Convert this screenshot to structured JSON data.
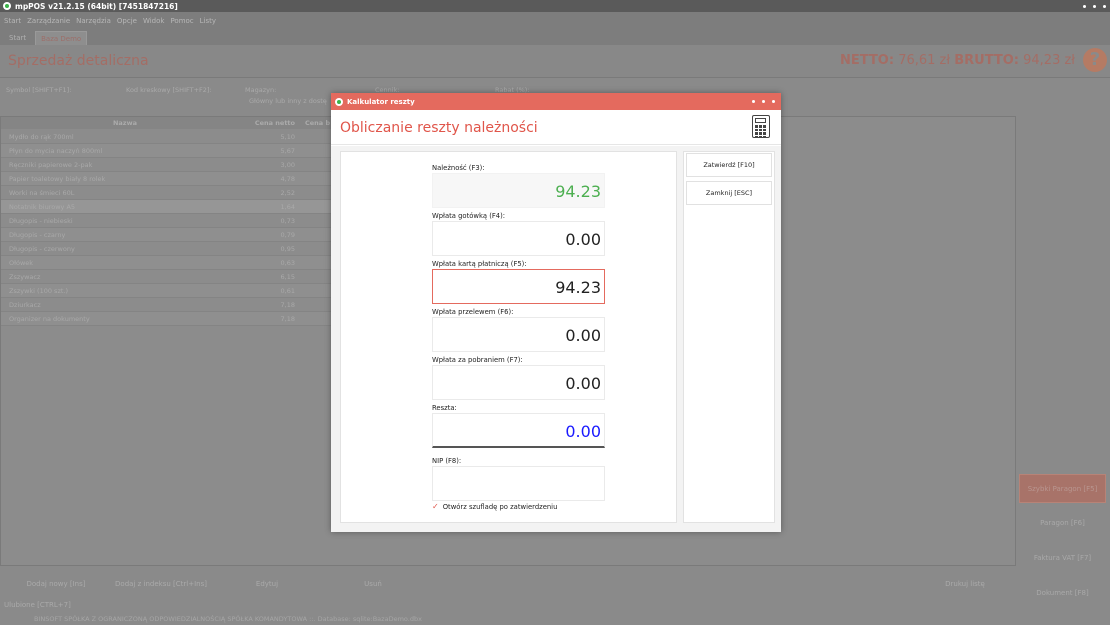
{
  "app": {
    "title": "mpPOS v21.2.15 (64bit) [7451847216]",
    "menu": [
      "Start",
      "Zarządzanie",
      "Narzędzia",
      "Opcje",
      "Widok",
      "Pomoc",
      "Listy"
    ],
    "tabs": [
      "Start",
      "Baza Demo"
    ],
    "page_title": "Sprzedaż detaliczna",
    "totals": {
      "netto_label": "NETTO:",
      "netto_value": "76,61 zł",
      "brutto_label": "BRUTTO:",
      "brutto_value": "94,23 zł"
    },
    "help_glyph": "?"
  },
  "fields": {
    "symbol": "Symbol [SHIFT+F1]:",
    "barcode": "Kod kreskowy [SHIFT+F2]:",
    "warehouse": "Magazyn:",
    "warehouse_value": "Główny lub inny z dostę",
    "pricelist": "Cennik:",
    "discount": "Rabat (%):"
  },
  "table": {
    "headers": [
      "Nazwa",
      "Cena netto",
      "Cena b"
    ],
    "rows": [
      {
        "name": "Mydło do rąk 700ml",
        "net": "5,10"
      },
      {
        "name": "Płyn do mycia naczyń 800ml",
        "net": "5,67"
      },
      {
        "name": "Ręczniki papierowe 2-pak",
        "net": "3,00"
      },
      {
        "name": "Papier toaletowy biały 8 rolek",
        "net": "4,78"
      },
      {
        "name": "Worki na śmieci 60L",
        "net": "2,52"
      },
      {
        "name": "Notatnik biurowy A5",
        "net": "1,64"
      },
      {
        "name": "Długopis - niebieski",
        "net": "0,73"
      },
      {
        "name": "Długopis - czarny",
        "net": "0,79"
      },
      {
        "name": "Długopis - czerwony",
        "net": "0,95"
      },
      {
        "name": "Ołówek",
        "net": "0,63"
      },
      {
        "name": "Zszywacz",
        "net": "6,15"
      },
      {
        "name": "Zszywki (100 szt.)",
        "net": "0,61"
      },
      {
        "name": "Dziurkacz",
        "net": "7,18"
      },
      {
        "name": "Organizer na dokumenty",
        "net": "7,18"
      }
    ]
  },
  "bottom": {
    "add_new": "Dodaj nowy [Ins]",
    "add_index": "Dodaj z indeksu [Ctrl+Ins]",
    "edit": "Edytuj",
    "remove": "Usuń",
    "print_list": "Drukuj listę",
    "favorites": "Ulubione [CTRL+7]",
    "status": "BINSOFT SPÓŁKA Z OGRANICZONĄ ODPOWIEDZIALNOŚCIĄ SPÓŁKA KOMANDYTOWA ::. Database: sqlite:BazaDemo.dbx"
  },
  "side": {
    "quick_receipt": "Szybki Paragon [F5]",
    "receipt": "Paragon [F6]",
    "invoice": "Faktura VAT [F7]",
    "document": "Dokument [F8]"
  },
  "dialog": {
    "title": "Kalkulator reszty",
    "heading": "Obliczanie reszty należności",
    "due_label": "Należność (F3):",
    "due_value": "94.23",
    "cash_label": "Wpłata gotówką (F4):",
    "cash_value": "0.00",
    "card_label": "Wpłata kartą płatniczą (F5):",
    "card_value": "94.23",
    "transfer_label": "Wpłata przelewem (F6):",
    "transfer_value": "0.00",
    "cod_label": "Wpłata za pobraniem (F7):",
    "cod_value": "0.00",
    "change_label": "Reszta:",
    "change_value": "0.00",
    "nip_label": "NIP (F8):",
    "nip_value": "",
    "drawer_label": "Otwórz szufladę po zatwierdzeniu",
    "confirm_button": "Zatwierdź [F10]",
    "close_button": "Zamknij [ESC]"
  },
  "colors": {
    "accent": "#e46a5e",
    "due": "#4caf50",
    "change": "#1a1aff"
  }
}
